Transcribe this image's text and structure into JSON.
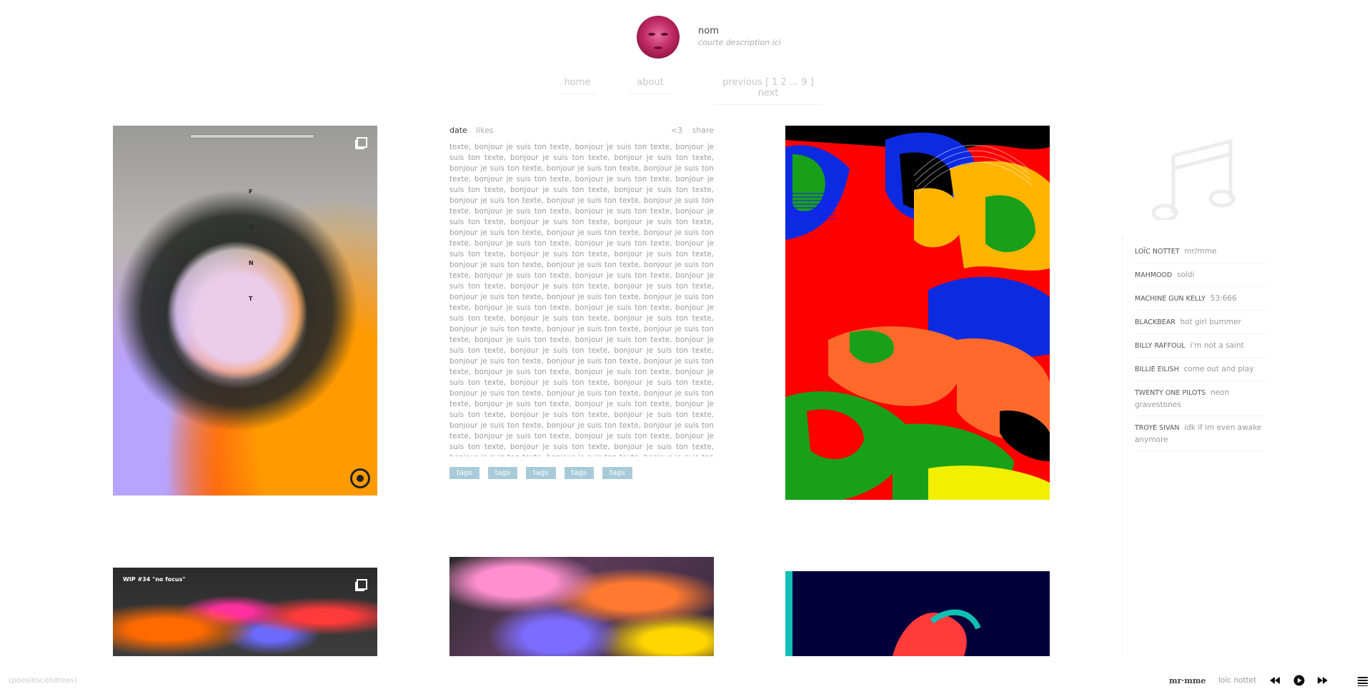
{
  "header": {
    "name": "nom",
    "description": "courte description ici"
  },
  "nav": {
    "home": "home",
    "about": "about",
    "pagination": "previous [ 1 2 ... 9 ] next"
  },
  "image_post_1": {
    "letters": [
      "F",
      "O",
      "N",
      "T"
    ]
  },
  "text_post": {
    "date": "date",
    "likes": "likes",
    "heart": "<3",
    "share": "share",
    "body": "texte, bonjour je suis ton texte, bonjour je suis ton texte, bonjour je suis ton texte, bonjour je suis ton texte, bonjour je suis ton texte, bonjour je suis ton texte, bonjour je suis ton texte, bonjour je suis ton texte, bonjour je suis ton texte, bonjour je suis ton texte, bonjour je suis ton texte, bonjour je suis ton texte, bonjour je suis ton texte, bonjour je suis ton texte, bonjour je suis ton texte, bonjour je suis ton texte, bonjour je suis ton texte, bonjour je suis ton texte, bonjour je suis ton texte, bonjour je suis ton texte, bonjour je suis ton texte, bonjour je suis ton texte, bonjour je suis ton texte, bonjour je suis ton texte, bonjour je suis ton texte, bonjour je suis ton texte, bonjour je suis ton texte, bonjour je suis ton texte, bonjour je suis ton texte, bonjour je suis ton texte, bonjour je suis ton texte, bonjour je suis ton texte, bonjour je suis ton texte, bonjour je suis ton texte, bonjour je suis ton texte, bonjour je suis ton texte, bonjour je suis ton texte, bonjour je suis ton texte, bonjour je suis ton texte, bonjour je suis ton texte, bonjour je suis ton texte, bonjour je suis ton texte, bonjour je suis ton texte, bonjour je suis ton texte, bonjour je suis ton texte, bonjour je suis ton texte, bonjour je suis ton texte, bonjour je suis ton texte, bonjour je suis ton texte, bonjour je suis ton texte, bonjour je suis ton texte, bonjour je suis ton texte, bonjour je suis ton texte, bonjour je suis ton texte, bonjour je suis ton texte, bonjour je suis ton texte, bonjour je suis ton texte, bonjour je suis ton texte, bonjour je suis ton texte, bonjour je suis ton texte, bonjour je suis ton texte, bonjour je suis ton texte, bonjour je suis ton texte, bonjour je suis ton texte, bonjour je suis ton texte, bonjour je suis ton texte, bonjour je suis ton texte, bonjour je suis ton texte, bonjour je suis ton texte, bonjour je suis ton texte, bonjour je suis ton texte, bonjour je suis ton texte, bonjour je suis ton texte, bonjour je suis ton texte, bonjour je suis ton texte, bonjour je suis ton texte, bonjour je suis ton texte, bonjour je suis ton texte, bonjour je suis ton texte, bonjour je suis ton texte, bonjour je suis ton texte, bonjour je suis ton texte, bonjour je suis ton texte, bonjour je suis ton texte, bonjour je suis ton texte, bonjour je suis ton texte, bonjour je suis ton texte, bonjour je suis ton texte, bonjour je suis ton texte, bonjour je suis ton texte, bonjour je suis ton texte, bonjour je suis ton texte, bonjour je suis ton texte, bonjour je suis ton texte, bonjour je suis ton texte, bonjour je suis ton texte, bonjour je suis ton texte, bonjour je suis ton texte, bonjour je suis ton texte, bonjour je suis ton texte, bonjour je suis ton texte, bonjour je suis ton texte, bonjour je suis ton texte,",
    "tags": [
      "tags",
      "tags",
      "tags",
      "tags",
      "tags"
    ]
  },
  "image_post_4": {
    "caption": "WIP #34 \"no focus\""
  },
  "playlist": [
    {
      "artist": "LOÏC NOTTET",
      "song": "mr/mme"
    },
    {
      "artist": "MAHMOOD",
      "song": "soldi"
    },
    {
      "artist": "MACHINE GUN KELLY",
      "song": "53:666"
    },
    {
      "artist": "BLACKBEAR",
      "song": "hot girl bummer"
    },
    {
      "artist": "BILLY RAFFOUL",
      "song": "i'm not a saint"
    },
    {
      "artist": "BILLIE EILISH",
      "song": "come out and play"
    },
    {
      "artist": "TWENTY ONE PILOTS",
      "song": "neon gravestones"
    },
    {
      "artist": "TROYE SIVAN",
      "song": "idk if im even awake anymore"
    }
  ],
  "footer": {
    "watermark": "(poesiescendrees)",
    "now_playing_title": "mr·mme",
    "now_playing_artist": "loïc nottet"
  },
  "icons": {
    "music_note": "music-note-icon",
    "rewind": "rewind-icon",
    "play": "play-icon",
    "fast_forward": "fast-forward-icon",
    "menu": "menu-icon",
    "gallery": "gallery-icon"
  },
  "colors": {
    "tag_bg": "#a9cbd9",
    "highlight": "#a9cbd9",
    "image3_bg": "#ff0000",
    "image6_bg": "#02003a"
  }
}
